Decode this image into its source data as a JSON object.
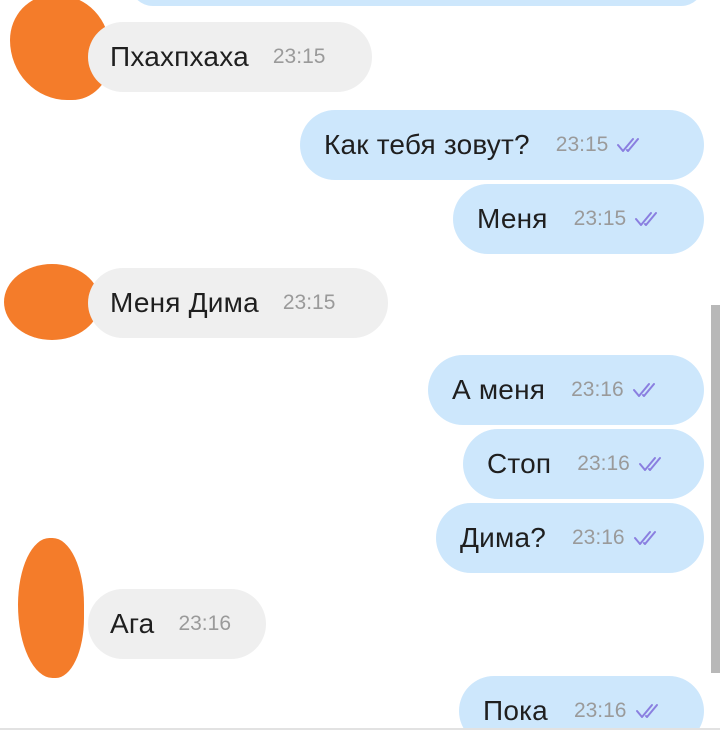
{
  "colors": {
    "incoming_bubble": "#efefef",
    "outgoing_bubble": "#cde7fc",
    "read_check": "#8a7fe0",
    "avatar_censor": "#f47c2a"
  },
  "messages": [
    {
      "direction": "incoming",
      "text": "Пхахпхаха",
      "time": "23:15"
    },
    {
      "direction": "outgoing",
      "text": "Как тебя зовут?",
      "time": "23:15",
      "status_icon": "double-check-icon"
    },
    {
      "direction": "outgoing",
      "text": "Меня",
      "time": "23:15",
      "status_icon": "double-check-icon"
    },
    {
      "direction": "incoming",
      "text": "Меня Дима",
      "time": "23:15"
    },
    {
      "direction": "outgoing",
      "text": "А меня",
      "time": "23:16",
      "status_icon": "double-check-icon"
    },
    {
      "direction": "outgoing",
      "text": "Стоп",
      "time": "23:16",
      "status_icon": "double-check-icon"
    },
    {
      "direction": "outgoing",
      "text": "Дима?",
      "time": "23:16",
      "status_icon": "double-check-icon"
    },
    {
      "direction": "incoming",
      "text": "Ага",
      "time": "23:16"
    },
    {
      "direction": "outgoing",
      "text": "Пока",
      "time": "23:16",
      "status_icon": "double-check-icon"
    }
  ]
}
